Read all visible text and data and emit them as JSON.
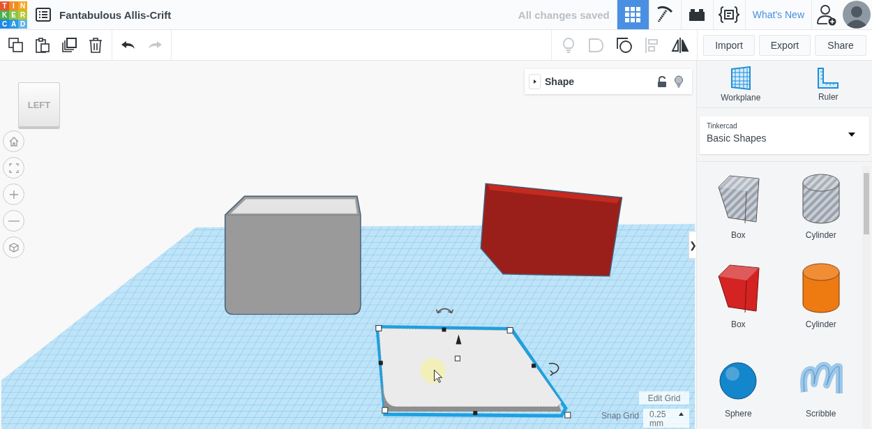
{
  "app_bar": {
    "logo": [
      {
        "letter": "T",
        "color": "#e8542c"
      },
      {
        "letter": "I",
        "color": "#f08c22"
      },
      {
        "letter": "N",
        "color": "#f5a623"
      },
      {
        "letter": "K",
        "color": "#4caf50"
      },
      {
        "letter": "E",
        "color": "#8bc34a"
      },
      {
        "letter": "R",
        "color": "#b5c834"
      },
      {
        "letter": "C",
        "color": "#1e88e5"
      },
      {
        "letter": "A",
        "color": "#2a9ae0"
      },
      {
        "letter": "D",
        "color": "#5fb4e8"
      }
    ],
    "title": "Fantabulous Allis-Crift",
    "save_status": "All changes saved",
    "views": [
      {
        "kind": "grid",
        "selected": true
      },
      {
        "kind": "pickaxe",
        "selected": false
      },
      {
        "kind": "bricks",
        "selected": false
      },
      {
        "kind": "code",
        "selected": false
      }
    ],
    "whats_new": "What's New"
  },
  "toolbar": {
    "edit_tools": [
      {
        "kind": "copy",
        "disabled": false
      },
      {
        "kind": "paste",
        "disabled": false
      },
      {
        "kind": "duplicate",
        "disabled": false
      },
      {
        "kind": "delete",
        "disabled": false
      }
    ],
    "history": [
      {
        "kind": "undo",
        "disabled": false
      },
      {
        "kind": "redo",
        "disabled": true
      }
    ],
    "shape_tools": [
      {
        "kind": "bulb",
        "disabled": true
      },
      {
        "kind": "hole",
        "disabled": true
      },
      {
        "kind": "group",
        "disabled": false
      },
      {
        "kind": "align",
        "disabled": true
      },
      {
        "kind": "mirror",
        "disabled": false
      }
    ],
    "buttons": [
      "Import",
      "Export",
      "Share"
    ]
  },
  "view_cube": {
    "face": "LEFT"
  },
  "nav_controls": [
    {
      "kind": "home"
    },
    {
      "kind": "fit"
    },
    {
      "kind": "zoom_in"
    },
    {
      "kind": "zoom_out"
    },
    {
      "kind": "projection"
    }
  ],
  "inspector": {
    "title": "Shape",
    "expanded": false,
    "locked": false
  },
  "grid_controls": {
    "edit_button": "Edit Grid",
    "snap_label": "Snap Grid",
    "snap_value": "0.25",
    "snap_unit": "mm"
  },
  "panel_toggle": "❯",
  "sidebar": {
    "tools": [
      {
        "kind": "workplane",
        "label": "Workplane"
      },
      {
        "kind": "ruler",
        "label": "Ruler"
      }
    ],
    "library": {
      "label": "Tinkercad",
      "value": "Basic Shapes"
    },
    "shapes": [
      {
        "kind": "box",
        "hole": true,
        "label": "Box"
      },
      {
        "kind": "cylinder",
        "hole": true,
        "label": "Cylinder"
      },
      {
        "kind": "box",
        "hole": false,
        "color": "#d42323",
        "label": "Box"
      },
      {
        "kind": "cylinder",
        "hole": false,
        "color": "#ee7a12",
        "label": "Cylinder"
      },
      {
        "kind": "sphere",
        "hole": false,
        "color": "#1386cc",
        "label": "Sphere"
      },
      {
        "kind": "scribble",
        "hole": false,
        "color": "#9cc8ea",
        "label": "Scribble"
      }
    ]
  }
}
